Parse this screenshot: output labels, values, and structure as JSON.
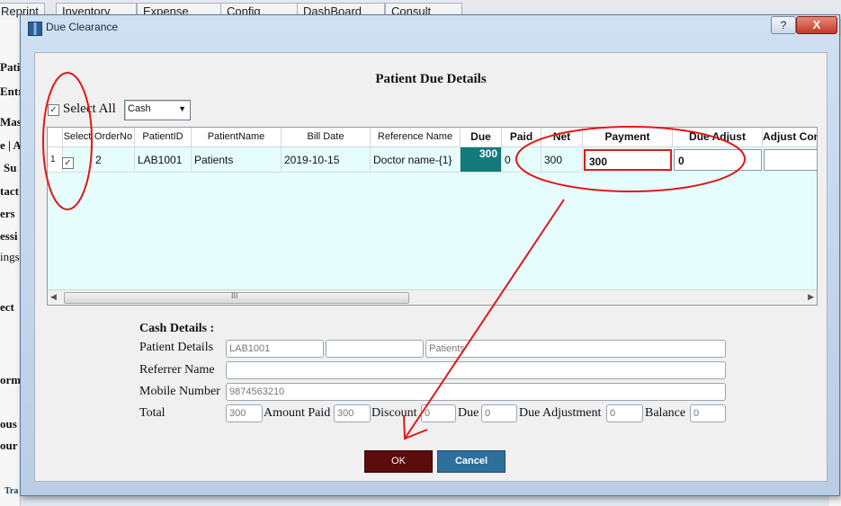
{
  "background": {
    "tabs": [
      "Reprint",
      "Inventory",
      "Expense",
      "Config",
      "DashBoard",
      "Consult"
    ],
    "left_items": [
      "Patient",
      "Entr",
      "Maste",
      "e | A",
      "Su",
      "tact",
      "ers",
      "essi",
      "ings",
      "ect",
      "ormed",
      "ous",
      "our",
      "Tra"
    ]
  },
  "dialog": {
    "title": "Due Clearance",
    "help": "?",
    "close": "X"
  },
  "page": {
    "heading": "Patient Due Details",
    "select_all_label": "Select All",
    "payment_mode": "Cash"
  },
  "grid": {
    "columns": [
      "Select",
      "OrderNo",
      "PatientID",
      "PatientName",
      "Bill Date",
      "Reference Name",
      "Due",
      "Paid",
      "Net",
      "Payment",
      "Due Adjust",
      "Adjust Con"
    ],
    "rows": [
      {
        "row_no": "1",
        "selected": true,
        "order_no": "2",
        "patient_id": "LAB1001",
        "patient_name": "Patients",
        "bill_date": "2019-10-15",
        "reference_name": "Doctor name-{1}",
        "due": "300",
        "paid": "0",
        "net": "300",
        "payment": "300",
        "due_adjust": "0",
        "adjust_con": ""
      }
    ],
    "scroll_grip": "III"
  },
  "cash_details": {
    "title": "Cash Details :",
    "patient_details_label": "Patient Details",
    "patient_id": "LAB1001",
    "patient_mid": "",
    "patient_name": "Patients",
    "referrer_label": "Referrer Name",
    "referrer_value": "",
    "mobile_label": "Mobile Number",
    "mobile_value": "9874563210",
    "total_label": "Total",
    "total_value": "300",
    "amount_paid_label": "Amount Paid",
    "amount_paid_value": "300",
    "discount_label": "Discount",
    "discount_value": "0",
    "due_label": "Due",
    "due_value": "0",
    "due_adjustment_label": "Due Adjustment",
    "due_adjustment_value": "0",
    "balance_label": "Balance",
    "balance_value": "0"
  },
  "buttons": {
    "ok": "OK",
    "cancel": "Cancel"
  },
  "colors": {
    "due_cell": "#127a7a",
    "ok_button": "#5b0c0c",
    "cancel_button": "#2e6f9c",
    "annotation": "#e01818",
    "grid_background": "#e6fdfd"
  }
}
